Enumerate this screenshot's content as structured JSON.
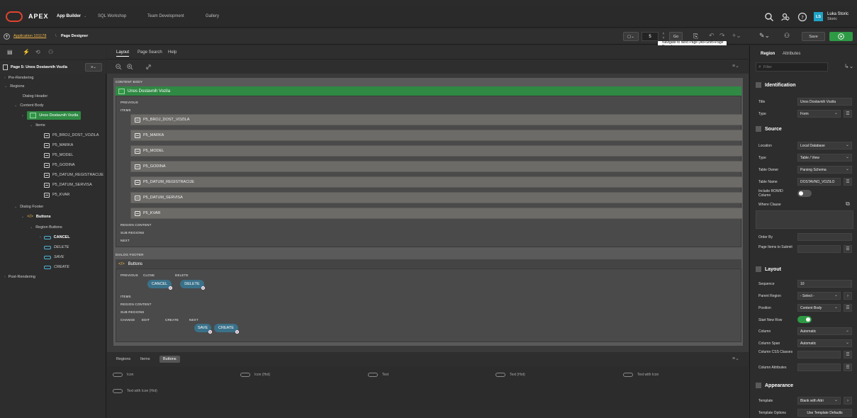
{
  "topbar": {
    "brand": "APEX",
    "nav": [
      "App Builder",
      "SQL Workshop",
      "Team Development",
      "Gallery"
    ],
    "user_initials": "LS",
    "user_first": "Luka Storic",
    "user_last": "Storic"
  },
  "bar2": {
    "app_link": "Application 101178",
    "page_label": "Page Designer",
    "page_number": "5",
    "go_label": "Go",
    "save_label": "Save",
    "tooltip": "Navigate to Next Page (Alt+Shift+Page Down)"
  },
  "left": {
    "page_title": "Page 5: Unos Dostavnih Vozila",
    "tree": {
      "pre_rendering": "Pre-Rendering",
      "regions": "Regions",
      "dialog_header": "Dialog Header",
      "content_body": "Content Body",
      "region_name": "Unos Dostavnih Vozila",
      "items_label": "Items",
      "items": [
        "P5_BROJ_DOST_VOZILA",
        "P5_MARKA",
        "P5_MODEL",
        "P5_GODINA",
        "P5_DATUM_REGISTRACIJE",
        "P5_DATUM_SERVISA",
        "P5_KVAR"
      ],
      "dialog_footer": "Dialog Footer",
      "buttons_region": "Buttons",
      "region_buttons": "Region Buttons",
      "buttons": [
        "CANCEL",
        "DELETE",
        "SAVE",
        "CREATE"
      ],
      "post_rendering": "Post-Rendering"
    }
  },
  "center": {
    "tabs": [
      "Layout",
      "Page Search",
      "Help"
    ],
    "content_body_label": "CONTENT BODY",
    "region_title": "Unos Dostavnih Vozila",
    "previous_label": "PREVIOUS",
    "items_label": "ITEMS",
    "items": [
      "P5_BROJ_DOST_VOZILA",
      "P5_MARKA",
      "P5_MODEL",
      "P5_GODINA",
      "P5_DATUM_REGISTRACIJE",
      "P5_DATUM_SERVISA",
      "P5_KVAR"
    ],
    "region_content": "REGION CONTENT",
    "sub_regions": "SUB REGIONS",
    "next_label": "NEXT",
    "dialog_footer_label": "DIALOG FOOTER",
    "buttons_region_title": "Buttons",
    "slot_previous": "PREVIOUS",
    "slot_close": "CLOSE",
    "slot_delete": "DELETE",
    "btn_cancel": "CANCEL",
    "btn_delete": "DELETE",
    "slot_items": "ITEMS",
    "slot_region_content": "REGION CONTENT",
    "slot_sub_regions": "SUB REGIONS",
    "slot_change": "CHANGE",
    "slot_edit": "EDIT",
    "slot_create": "CREATE",
    "slot_next": "NEXT",
    "btn_save": "SAVE",
    "btn_create": "CREATE",
    "bottom_tabs": [
      "Regions",
      "Items",
      "Buttons"
    ],
    "gallery": [
      "Icon",
      "Icon (Hot)",
      "Text",
      "Text (Hot)",
      "Text with Icon",
      "Text with Icon (Hot)"
    ]
  },
  "right": {
    "tabs": [
      "Region",
      "Attributes"
    ],
    "filter_placeholder": "Filter",
    "identification": "Identification",
    "title_label": "Title",
    "title_value": "Unos Dostavnih Vozila",
    "type_label": "Type",
    "type_value": "Form",
    "source": "Source",
    "location_label": "Location",
    "location_value": "Local Database",
    "src_type_label": "Type",
    "src_type_value": "Table / View",
    "table_owner_label": "Table Owner",
    "table_owner_value": "Parsing Schema",
    "table_name_label": "Table Name",
    "table_name_value": "DOSTAVNO_VOZILO",
    "rowid_label": "Include ROWID Column",
    "where_label": "Where Clause",
    "order_label": "Order By",
    "submit_label": "Page Items to Submit",
    "layout": "Layout",
    "sequence_label": "Sequence",
    "sequence_value": "10",
    "parent_label": "Parent Region",
    "parent_value": "- Select -",
    "position_label": "Position",
    "position_value": "Content Body",
    "startrow_label": "Start New Row",
    "column_label": "Column",
    "column_value": "Automatic",
    "colspan_label": "Column Span",
    "colspan_value": "Automatic",
    "colcss_label": "Column CSS Classes",
    "colattr_label": "Column Attributes",
    "appearance": "Appearance",
    "template_label": "Template",
    "template_value": "Blank with Attri",
    "tplopt_label": "Template Options",
    "tplopt_value": "Use Template Defaults"
  }
}
